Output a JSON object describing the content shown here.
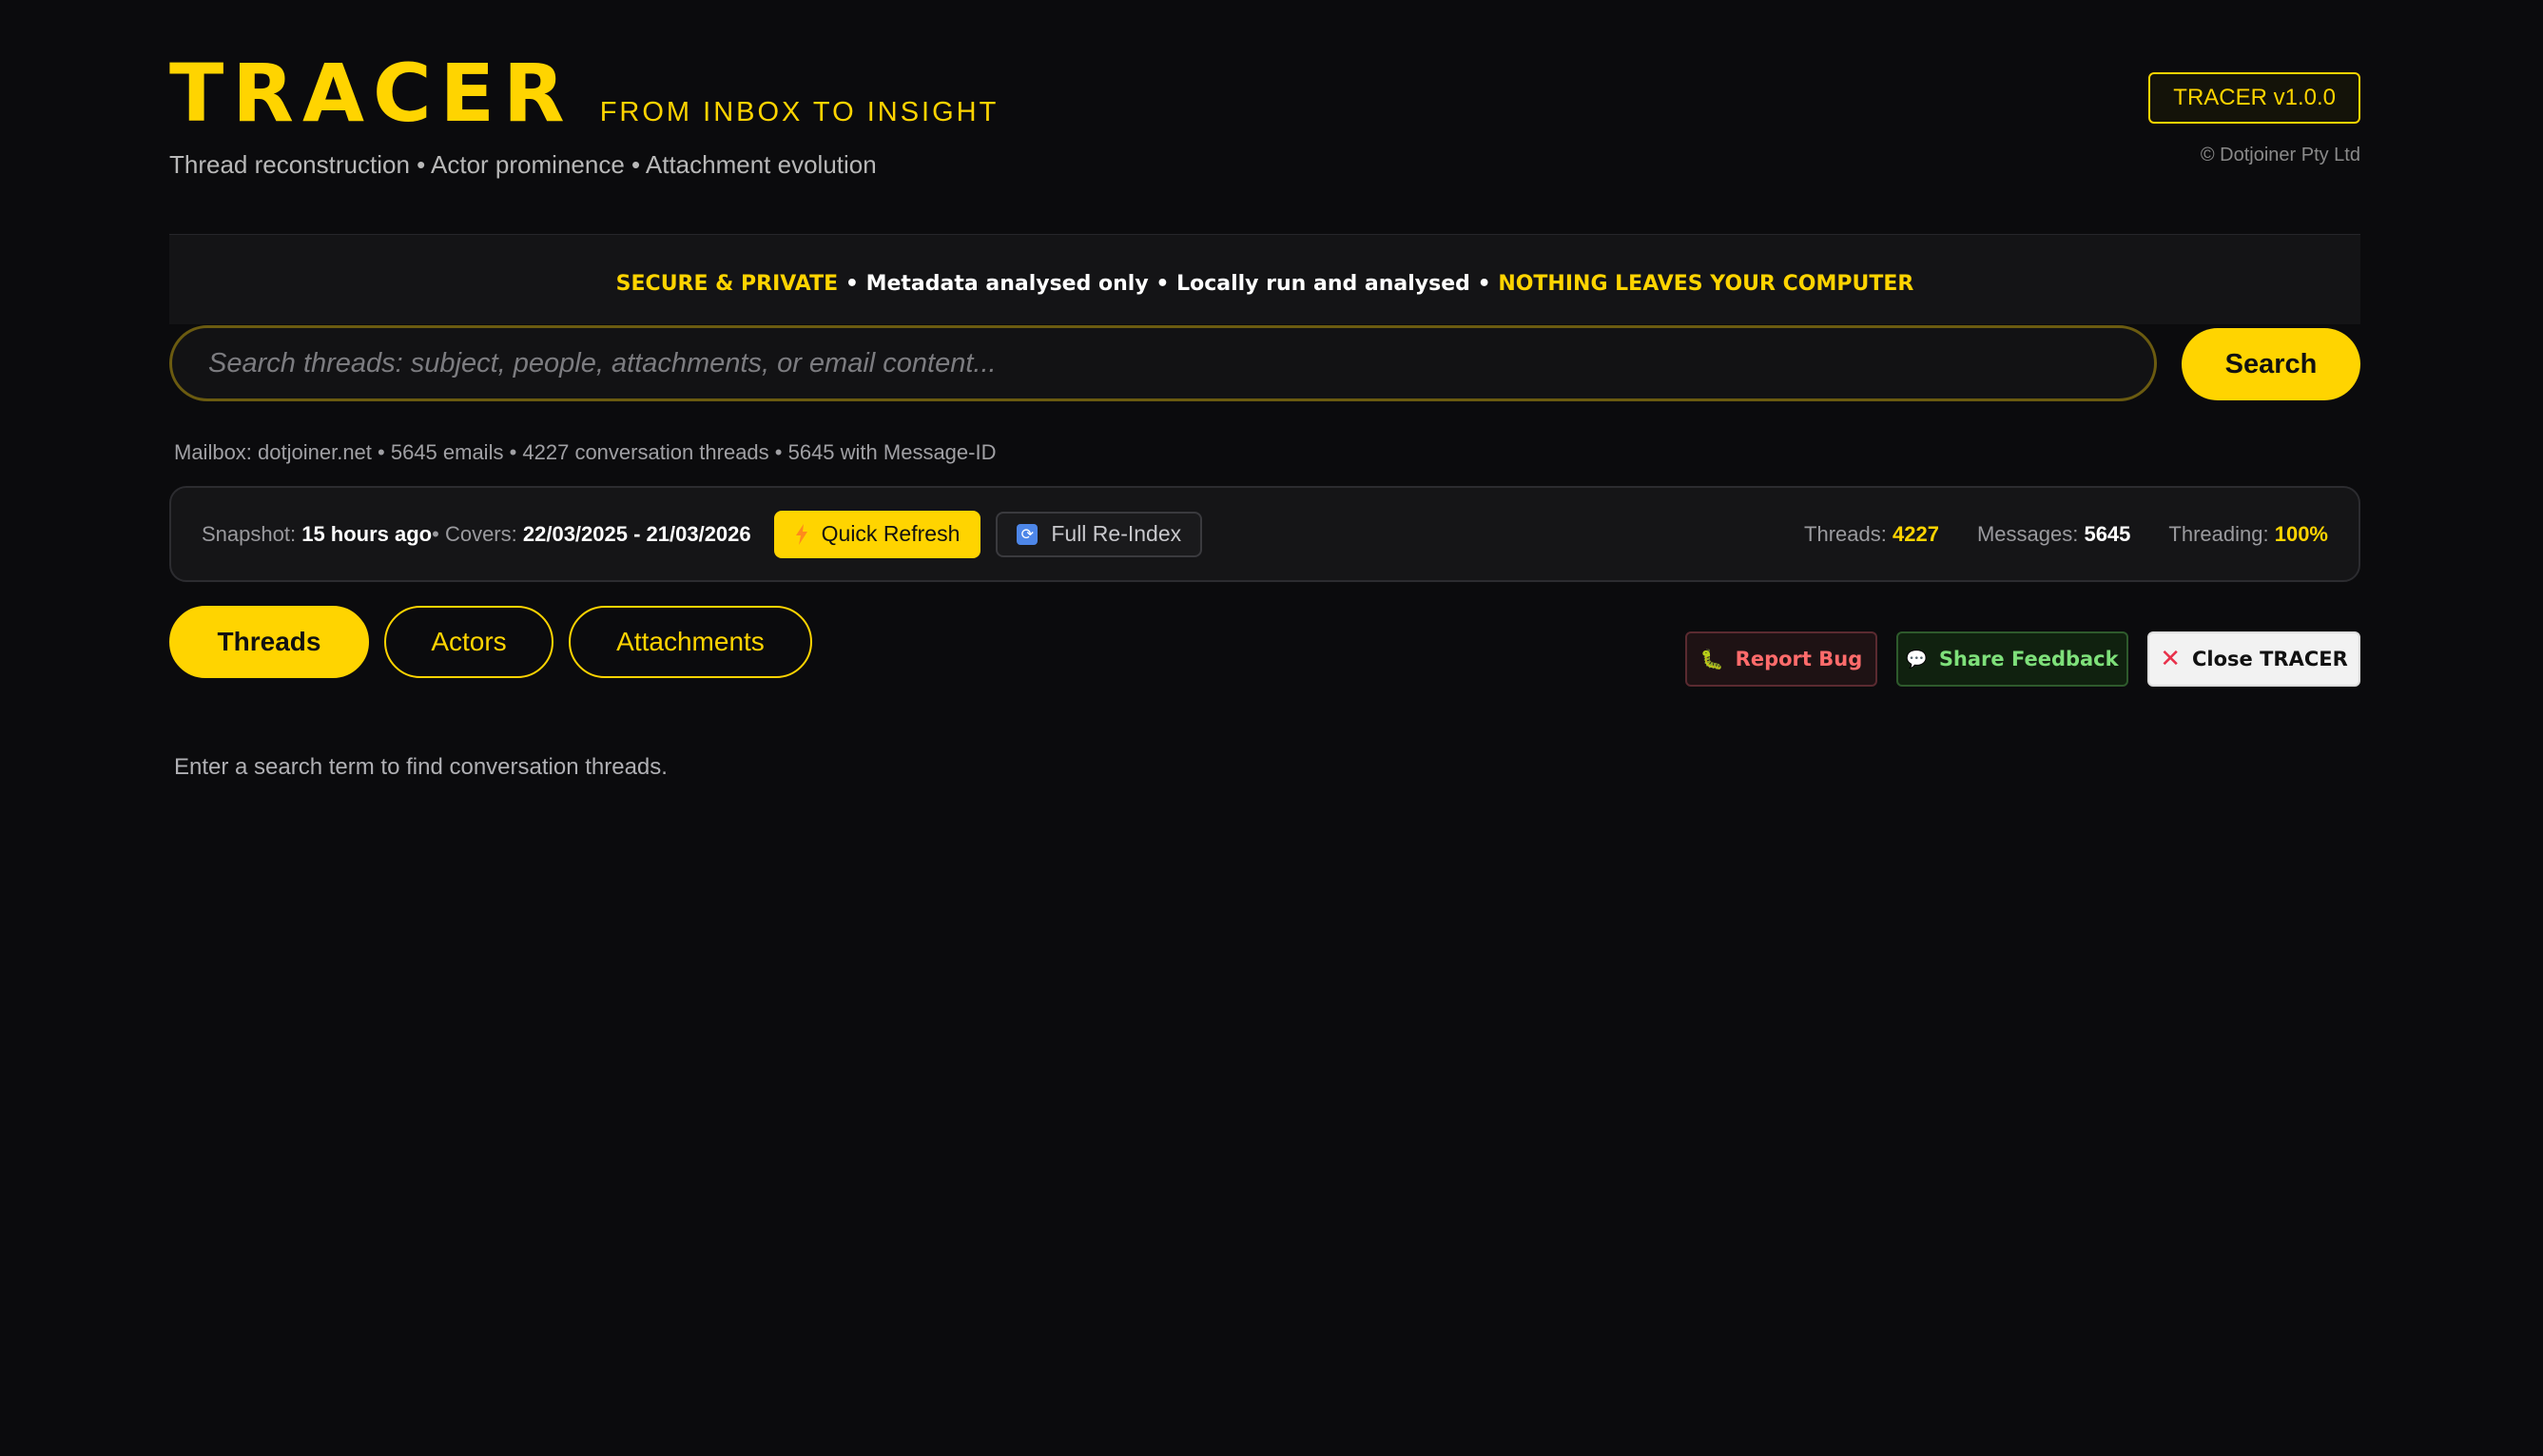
{
  "header": {
    "title": "TRACER",
    "tagline": "FROM INBOX TO INSIGHT",
    "subtitle": "Thread reconstruction • Actor prominence • Attachment evolution",
    "version": "TRACER v1.0.0",
    "copyright": "© Dotjoiner Pty Ltd"
  },
  "privacy": {
    "part1": "SECURE & PRIVATE",
    "sep1": " • ",
    "part2": "Metadata analysed only",
    "sep2": " • ",
    "part3": "Locally run and analysed",
    "sep3": " • ",
    "part4": "NOTHING LEAVES YOUR COMPUTER"
  },
  "search": {
    "placeholder": "Search threads: subject, people, attachments, or email content...",
    "value": "",
    "button_label": "Search"
  },
  "mailbox_info": "Mailbox: dotjoiner.net • 5645 emails • 4227 conversation threads • 5645 with Message-ID",
  "status": {
    "snapshot_label": "Snapshot:",
    "snapshot_value": "15 hours ago",
    "covers_label": " • Covers:",
    "covers_value": "22/03/2025 - 21/03/2026",
    "quick_refresh_label": "Quick Refresh",
    "full_reindex_label": "Full Re-Index",
    "threads_label": "Threads:",
    "threads_value": "4227",
    "messages_label": "Messages:",
    "messages_value": "5645",
    "threading_label": "Threading:",
    "threading_value": "100%"
  },
  "tabs": [
    {
      "label": "Threads",
      "active": true
    },
    {
      "label": "Actors",
      "active": false
    },
    {
      "label": "Attachments",
      "active": false
    }
  ],
  "actions": {
    "report_bug": "Report Bug",
    "share_feedback": "Share Feedback",
    "close_tracer": "Close TRACER"
  },
  "empty_message": "Enter a search term to find conversation threads.",
  "icons": {
    "quick_refresh": "lightning-bolt-icon",
    "full_reindex": "refresh-icon",
    "report_bug": "bug-icon",
    "share_feedback": "speech-bubble-icon",
    "close_tracer": "close-x-icon"
  },
  "colors": {
    "accent": "#ffd400",
    "background": "#0b0b0d",
    "report_bug": "#ff6b6b",
    "share_feedback": "#7ee07a",
    "close_icon": "#e8304a"
  }
}
